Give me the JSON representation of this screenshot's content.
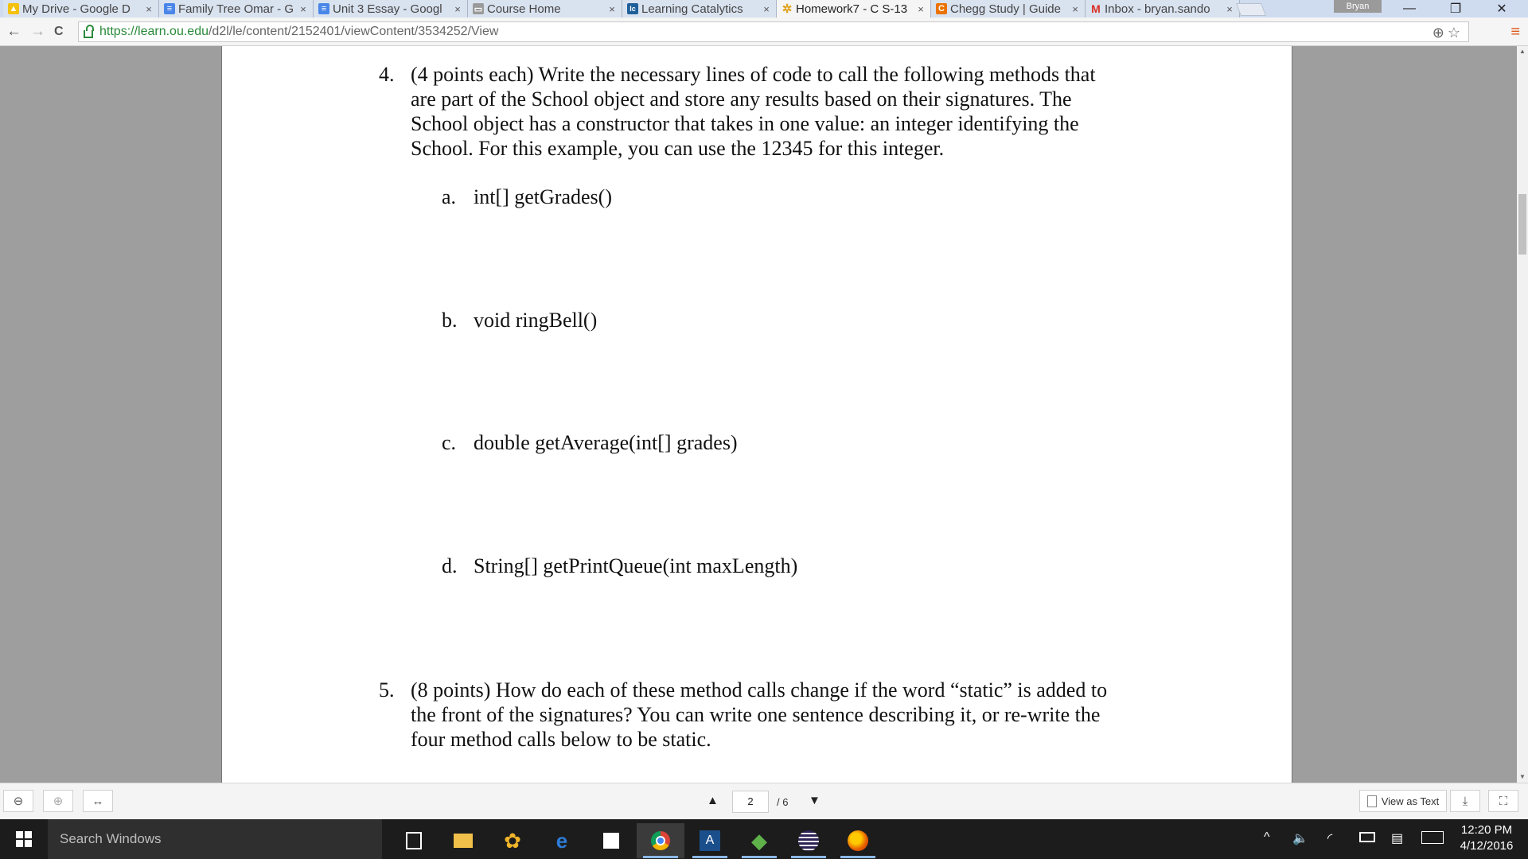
{
  "browser": {
    "tabs": [
      {
        "title": "My Drive - Google D",
        "favicon": "drive-icon"
      },
      {
        "title": "Family Tree Omar - G",
        "favicon": "docs-icon"
      },
      {
        "title": "Unit 3 Essay - Googl",
        "favicon": "docs-icon"
      },
      {
        "title": "Course Home",
        "favicon": "page-icon"
      },
      {
        "title": "Learning Catalytics",
        "favicon": "lc-icon"
      },
      {
        "title": "Homework7 - C S-13",
        "favicon": "loading-icon"
      },
      {
        "title": "Chegg Study | Guide",
        "favicon": "chegg-icon"
      },
      {
        "title": "Inbox - bryan.sando",
        "favicon": "gmail-icon"
      }
    ],
    "active_tab_index": 5,
    "close_glyph": "×",
    "profile_name": "Bryan",
    "url_host": "https://learn.ou.edu",
    "url_path": "/d2l/le/content/2152401/viewContent/3534252/View",
    "window_controls": {
      "minimize": "—",
      "restore": "❐",
      "close": "✕"
    },
    "nav_glyphs": {
      "back": "←",
      "forward": "→",
      "reload": "C",
      "zoom": "⊕",
      "star": "☆",
      "menu": "≡"
    }
  },
  "document": {
    "question4": {
      "number": "4.",
      "text": "(4 points each) Write the necessary lines of code to call the following methods that\nare part of the School object and store any results based on their signatures.  The\nSchool object has a constructor that takes in one value: an integer identifying the\nSchool.  For this example, you can use the 12345 for this integer.",
      "parts": [
        {
          "letter": "a.",
          "text": "int[] getGrades()"
        },
        {
          "letter": "b.",
          "text": "void ringBell()"
        },
        {
          "letter": "c.",
          "text": "double getAverage(int[] grades)"
        },
        {
          "letter": "d.",
          "text": "String[] getPrintQueue(int maxLength)"
        }
      ]
    },
    "question5": {
      "number": "5.",
      "text": "(8 points) How do each of these method calls change if the word “static” is added to\nthe front of the signatures?  You can write one sentence describing it, or re-write the\nfour method calls below to be static."
    }
  },
  "pdf_toolbar": {
    "current_page": "2",
    "total_pages": "/ 6",
    "view_as_text": "View as Text",
    "zoom_out": "⊖",
    "zoom_in": "⊕",
    "fit_width": "↔",
    "prev_page": "▲",
    "next_page": "▼",
    "download": "⤓",
    "fullscreen": "⛶"
  },
  "taskbar": {
    "search_placeholder": "Search Windows",
    "time": "12:20 PM",
    "date": "4/12/2016"
  }
}
